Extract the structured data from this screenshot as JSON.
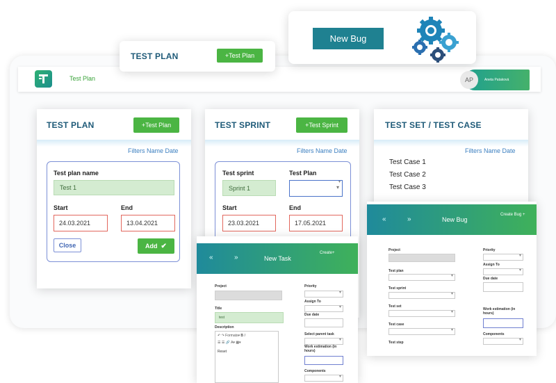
{
  "floating_testplan": {
    "title": "TEST PLAN",
    "button": "+Test Plan"
  },
  "floating_newbug": {
    "button": "New Bug"
  },
  "app": {
    "nav_label": "Test Plan",
    "avatar_initials": "AP",
    "user_name": "Aneta Pataková"
  },
  "test_plan": {
    "title": "TEST PLAN",
    "add_button": "+Test Plan",
    "filters": "Filters Name Date",
    "name_label": "Test plan name",
    "name_value": "Test 1",
    "start_label": "Start",
    "start_value": "24.03.2021",
    "end_label": "End",
    "end_value": "13.04.2021",
    "close_button": "Close",
    "add_submit": "Add"
  },
  "test_sprint": {
    "title": "TEST SPRINT",
    "add_button": "+Test Sprint",
    "filters": "Filters Name Date",
    "sprint_label": "Test sprint",
    "sprint_value": "Sprint 1",
    "plan_label": "Test Plan",
    "start_label": "Start",
    "start_value": "23.03.2021",
    "end_label": "End",
    "end_value": "17.05.2021"
  },
  "test_set": {
    "title": "TEST SET / TEST CASE",
    "filters": "Filters Name Date",
    "cases": [
      "Test Case 1",
      "Test Case 2",
      "Test Case 3"
    ]
  },
  "new_bug": {
    "title": "New Bug",
    "create": "Create Bug +",
    "left_labels": [
      "Project",
      "Test plan",
      "Test sprint",
      "Test set",
      "Test case",
      "Test step"
    ],
    "right_labels": [
      "Priority",
      "Assign To",
      "Due date",
      "Work estimation (in hours)",
      "Components"
    ]
  },
  "new_task": {
    "title": "New Task",
    "create": "Create+",
    "project_label": "Project",
    "title_label": "Title",
    "title_value": "test",
    "description_label": "Description",
    "editor_format": "Formats",
    "editor_body": "Reset",
    "right_labels": [
      "Priority",
      "Assign To",
      "Due date",
      "Select parent task",
      "Work estimation (in hours)",
      "Components"
    ]
  },
  "colors": {
    "accent_green": "#4bb543",
    "header_teal": "#1f8a9b",
    "title_blue": "#1e5a78",
    "error_red": "#e2675d",
    "link_blue": "#3b7fc0"
  },
  "icons": [
    "logo-icon",
    "gears-icon",
    "check-icon",
    "chevron-left-icon",
    "chevron-right-icon"
  ]
}
